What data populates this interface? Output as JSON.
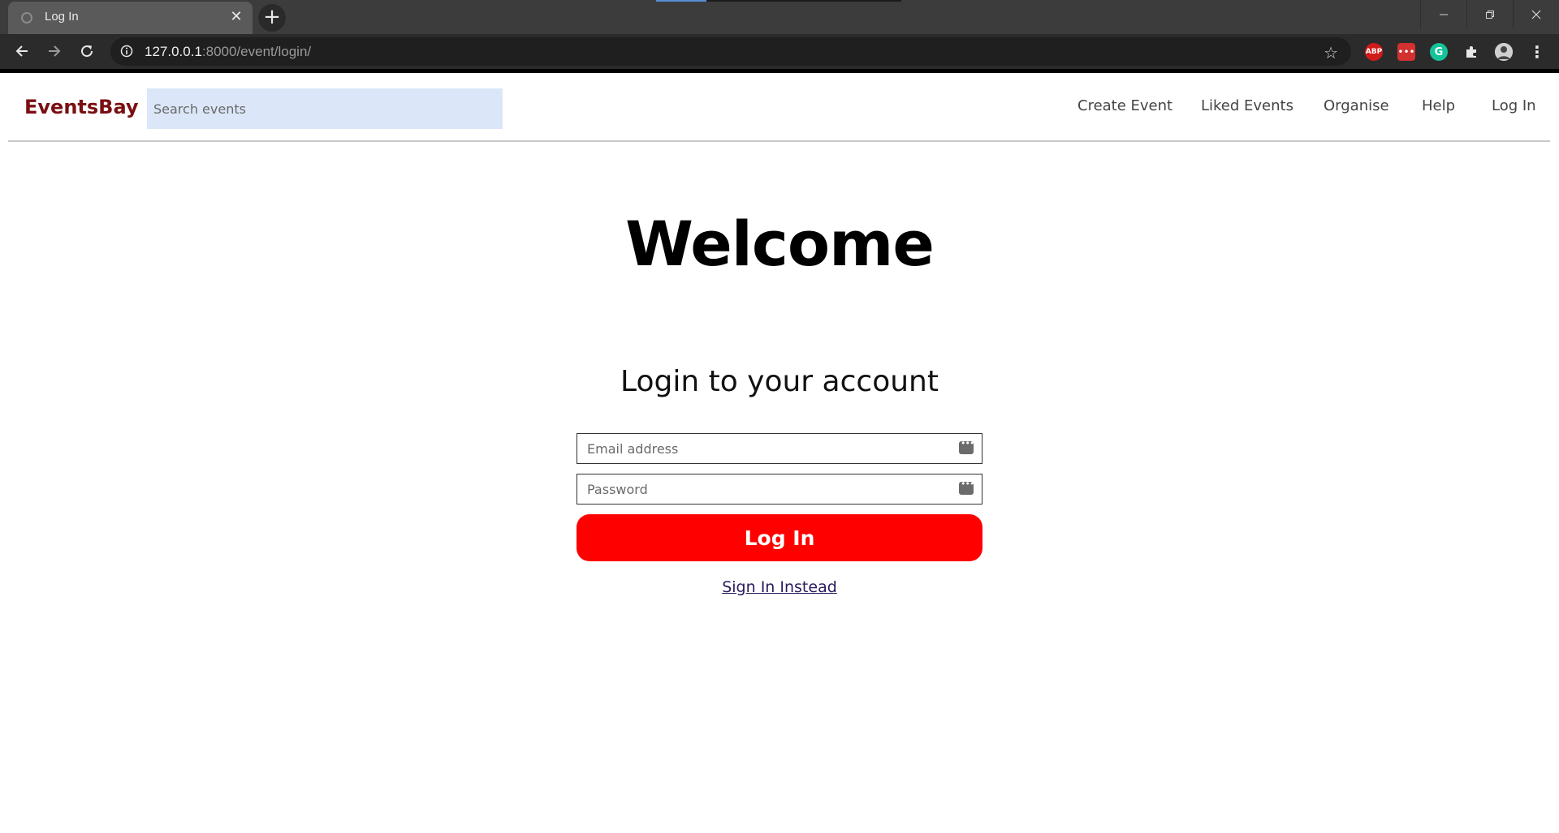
{
  "browser": {
    "tab_title": "Log In",
    "url_host": "127.0.0.1",
    "url_rest": ":8000/event/login/",
    "extensions": [
      {
        "name": "adblock-plus-icon",
        "label": "ABP",
        "color": "#d01b1b"
      },
      {
        "name": "password-manager-icon",
        "label": "•••",
        "color": "#d33030"
      },
      {
        "name": "grammarly-icon",
        "label": "G",
        "color": "#15c39a"
      }
    ]
  },
  "header": {
    "logo": "EventsBay",
    "search_placeholder": "Search events",
    "nav": [
      "Create Event",
      "Liked Events",
      "Organise",
      "Help",
      "Log In"
    ]
  },
  "main": {
    "welcome": "Welcome",
    "subtitle": "Login to your account",
    "email_placeholder": "Email address",
    "password_placeholder": "Password",
    "login_button": "Log In",
    "signin_link": "Sign In Instead"
  },
  "colors": {
    "logo": "#7a0f12",
    "search_bg": "#dbe7f8",
    "primary_button": "#ff0000"
  }
}
